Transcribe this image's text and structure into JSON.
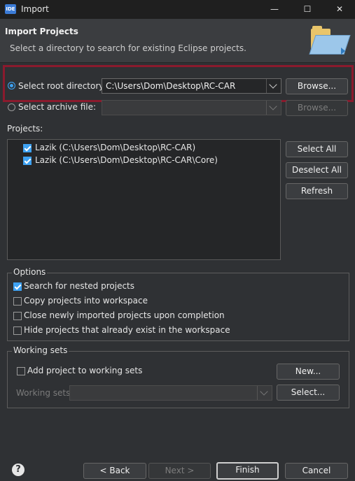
{
  "window": {
    "app_icon_text": "IDE",
    "title": "Import",
    "minimize_glyph": "—",
    "maximize_glyph": "☐",
    "close_glyph": "✕"
  },
  "header": {
    "title": "Import Projects",
    "description": "Select a directory to search for existing Eclipse projects.",
    "icon": "folder-import-icon"
  },
  "source": {
    "root_dir_label": "Select root directory:",
    "root_dir_selected": true,
    "root_dir_value": "C:\\Users\\Dom\\Desktop\\RC-CAR",
    "root_browse_label": "Browse...",
    "archive_label": "Select archive file:",
    "archive_value": "",
    "archive_browse_label": "Browse..."
  },
  "projects": {
    "label": "Projects:",
    "items": [
      {
        "label": "Lazik (C:\\Users\\Dom\\Desktop\\RC-CAR)",
        "checked": true
      },
      {
        "label": "Lazik (C:\\Users\\Dom\\Desktop\\RC-CAR\\Core)",
        "checked": true
      }
    ],
    "select_all_label": "Select All",
    "deselect_all_label": "Deselect All",
    "refresh_label": "Refresh"
  },
  "options": {
    "title": "Options",
    "items": [
      {
        "label": "Search for nested projects",
        "checked": true
      },
      {
        "label": "Copy projects into workspace",
        "checked": false
      },
      {
        "label": "Close newly imported projects upon completion",
        "checked": false
      },
      {
        "label": "Hide projects that already exist in the workspace",
        "checked": false
      }
    ]
  },
  "working_sets": {
    "title": "Working sets",
    "add_label": "Add project to working sets",
    "add_checked": false,
    "new_label": "New...",
    "sets_label": "Working sets:",
    "sets_value": "",
    "select_label": "Select..."
  },
  "footer": {
    "help": "?",
    "back_label": "< Back",
    "next_label": "Next >",
    "finish_label": "Finish",
    "cancel_label": "Cancel"
  },
  "colors": {
    "accent": "#3ea2f3",
    "highlight_box": "#8b1a2d",
    "background": "#2f3134"
  }
}
